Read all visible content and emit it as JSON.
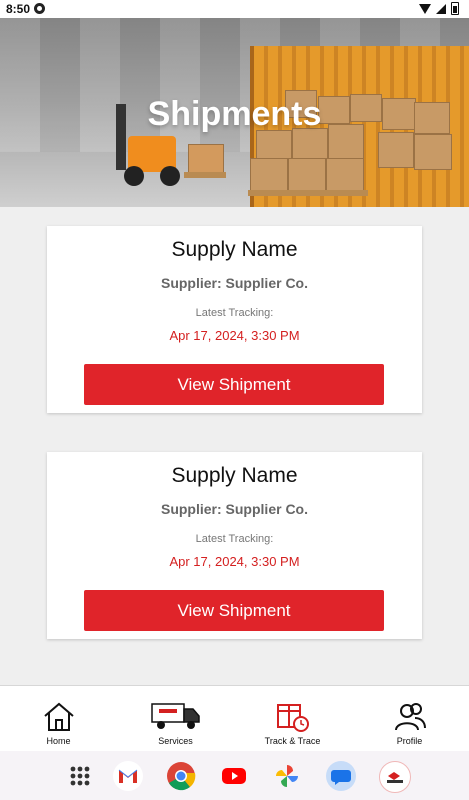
{
  "status_bar": {
    "time": "8:50"
  },
  "header": {
    "title": "Shipments"
  },
  "shipments": [
    {
      "name": "Supply Name",
      "supplier": "Supplier: Supplier Co.",
      "tracking_label": "Latest Tracking:",
      "tracking_date": "Apr 17, 2024, 3:30 PM",
      "button_label": "View Shipment"
    },
    {
      "name": "Supply Name",
      "supplier": "Supplier: Supplier Co.",
      "tracking_label": "Latest Tracking:",
      "tracking_date": "Apr 17, 2024, 3:30 PM",
      "button_label": "View Shipment"
    }
  ],
  "bottom_nav": {
    "items": [
      {
        "label": "Home",
        "icon": "home-icon"
      },
      {
        "label": "Services",
        "icon": "truck-icon"
      },
      {
        "label": "Track & Trace",
        "icon": "package-clock-icon"
      },
      {
        "label": "Profile",
        "icon": "users-icon"
      }
    ]
  },
  "dock": {
    "apps": [
      "app-drawer-icon",
      "gmail-icon",
      "chrome-icon",
      "youtube-icon",
      "photos-icon",
      "messages-icon",
      "cargo-app-icon"
    ]
  },
  "colors": {
    "accent_red": "#e0242a",
    "tracking_red": "#d42020",
    "container_orange": "#e59a2b"
  }
}
